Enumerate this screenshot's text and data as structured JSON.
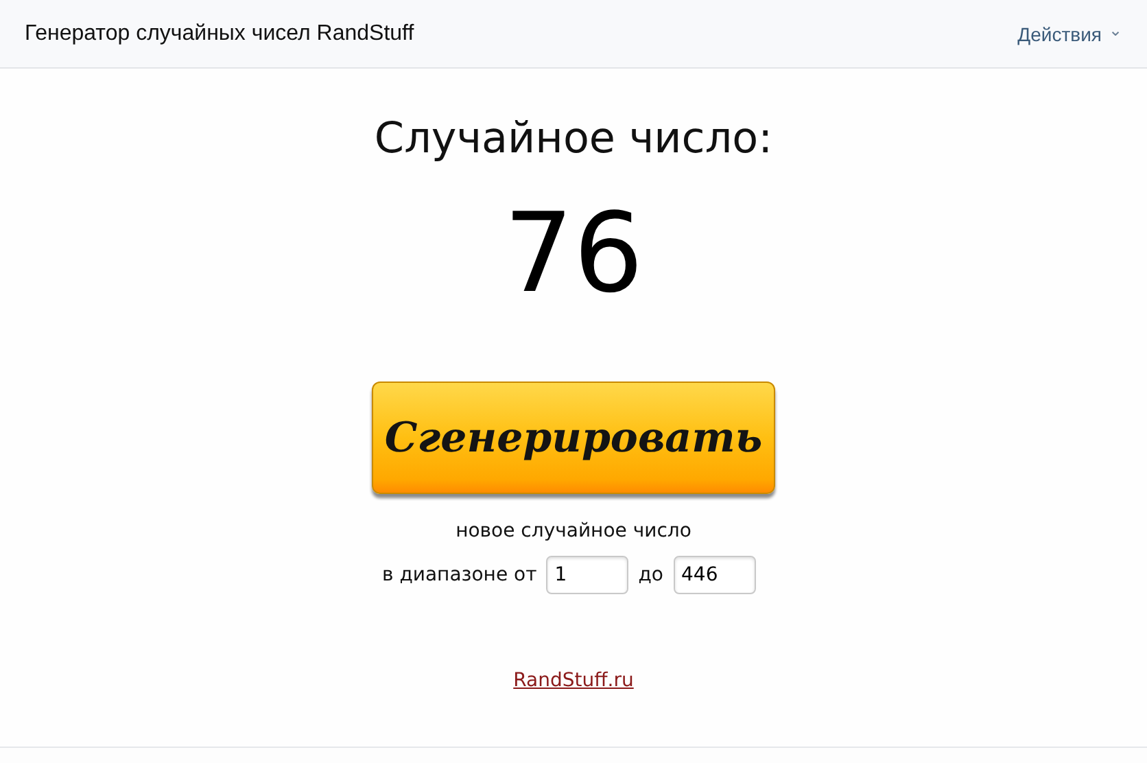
{
  "header": {
    "title": "Генератор случайных чисел RandStuff",
    "actions_menu": {
      "label": "Действия",
      "caret": "⌄"
    }
  },
  "result": {
    "heading": "Случайное число:",
    "value": "76"
  },
  "generate_button": {
    "label": "Сгенерировать"
  },
  "caption": "новое случайное число",
  "range": {
    "label_from": "в диапазоне от",
    "from": "1",
    "label_to": "до",
    "to": "446"
  },
  "footer_link": "RandStuff.ru"
}
